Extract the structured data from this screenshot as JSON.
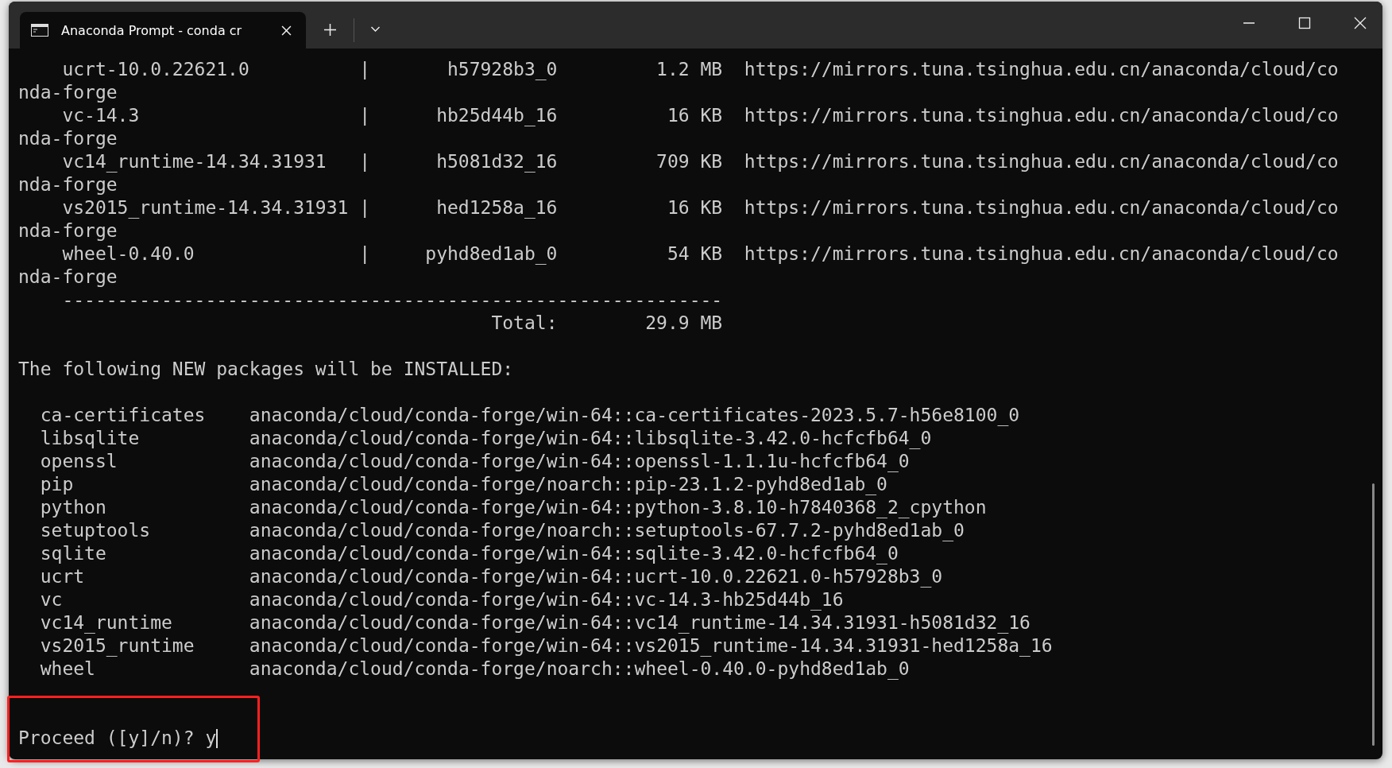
{
  "window": {
    "tabs": [
      {
        "title": "Anaconda Prompt - conda cr",
        "selected": true
      }
    ]
  },
  "download_rows": [
    {
      "name": "ucrt-10.0.22621.0",
      "separator": "|",
      "build": "h57928b3_0",
      "size": "1.2 MB",
      "url": "https://mirrors.tuna.tsinghua.edu.cn/anaconda/cloud/co",
      "url_wrap": "nda-forge"
    },
    {
      "name": "vc-14.3",
      "separator": "|",
      "build": "hb25d44b_16",
      "size": "16 KB",
      "url": "https://mirrors.tuna.tsinghua.edu.cn/anaconda/cloud/co",
      "url_wrap": "nda-forge"
    },
    {
      "name": "vc14_runtime-14.34.31931",
      "separator": "|",
      "build": "h5081d32_16",
      "size": "709 KB",
      "url": "https://mirrors.tuna.tsinghua.edu.cn/anaconda/cloud/co",
      "url_wrap": "nda-forge"
    },
    {
      "name": "vs2015_runtime-14.34.31931",
      "separator": "|",
      "build": "hed1258a_16",
      "size": "16 KB",
      "url": "https://mirrors.tuna.tsinghua.edu.cn/anaconda/cloud/co",
      "url_wrap": "nda-forge"
    },
    {
      "name": "wheel-0.40.0",
      "separator": "|",
      "build": "pyhd8ed1ab_0",
      "size": "54 KB",
      "url": "https://mirrors.tuna.tsinghua.edu.cn/anaconda/cloud/co",
      "url_wrap": "nda-forge"
    }
  ],
  "rule": "------------------------------------------------------------",
  "total": {
    "label": "Total:",
    "size": "29.9 MB"
  },
  "heading": "The following NEW packages will be INSTALLED:",
  "packages": [
    {
      "name": "ca-certificates",
      "spec": "anaconda/cloud/conda-forge/win-64::ca-certificates-2023.5.7-h56e8100_0"
    },
    {
      "name": "libsqlite",
      "spec": "anaconda/cloud/conda-forge/win-64::libsqlite-3.42.0-hcfcfb64_0"
    },
    {
      "name": "openssl",
      "spec": "anaconda/cloud/conda-forge/win-64::openssl-1.1.1u-hcfcfb64_0"
    },
    {
      "name": "pip",
      "spec": "anaconda/cloud/conda-forge/noarch::pip-23.1.2-pyhd8ed1ab_0"
    },
    {
      "name": "python",
      "spec": "anaconda/cloud/conda-forge/win-64::python-3.8.10-h7840368_2_cpython"
    },
    {
      "name": "setuptools",
      "spec": "anaconda/cloud/conda-forge/noarch::setuptools-67.7.2-pyhd8ed1ab_0"
    },
    {
      "name": "sqlite",
      "spec": "anaconda/cloud/conda-forge/win-64::sqlite-3.42.0-hcfcfb64_0"
    },
    {
      "name": "ucrt",
      "spec": "anaconda/cloud/conda-forge/win-64::ucrt-10.0.22621.0-h57928b3_0"
    },
    {
      "name": "vc",
      "spec": "anaconda/cloud/conda-forge/win-64::vc-14.3-hb25d44b_16"
    },
    {
      "name": "vc14_runtime",
      "spec": "anaconda/cloud/conda-forge/win-64::vc14_runtime-14.34.31931-h5081d32_16"
    },
    {
      "name": "vs2015_runtime",
      "spec": "anaconda/cloud/conda-forge/win-64::vs2015_runtime-14.34.31931-hed1258a_16"
    },
    {
      "name": "wheel",
      "spec": "anaconda/cloud/conda-forge/noarch::wheel-0.40.0-pyhd8ed1ab_0"
    }
  ],
  "prompt": {
    "text": "Proceed ([y]/n)?",
    "input": "y"
  }
}
